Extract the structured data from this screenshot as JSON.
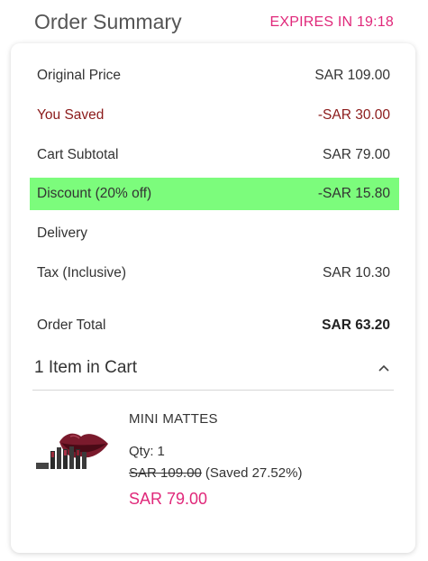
{
  "header": {
    "title": "Order Summary",
    "expires": "EXPIRES IN 19:18"
  },
  "summary": {
    "original_price": {
      "label": "Original Price",
      "value": "SAR 109.00"
    },
    "you_saved": {
      "label": "You Saved",
      "value": "-SAR 30.00"
    },
    "cart_subtotal": {
      "label": "Cart Subtotal",
      "value": "SAR 79.00"
    },
    "discount": {
      "label": "Discount (20% off)",
      "value": "-SAR 15.80"
    },
    "delivery": {
      "label": "Delivery",
      "value": ""
    },
    "tax": {
      "label": "Tax (Inclusive)",
      "value": "SAR 10.30"
    },
    "order_total": {
      "label": "Order Total",
      "value": "SAR 63.20"
    }
  },
  "cart": {
    "title": "1 Item in Cart",
    "toggle_icon": "chevron-up-icon",
    "items": [
      {
        "name": "MINI MATTES",
        "qty_label": "Qty:",
        "qty_value": "1",
        "original_price": "SAR 109.00",
        "saved_note": "(Saved 27.52%)",
        "price": "SAR 79.00",
        "image": "lipstick-product-image"
      }
    ]
  },
  "colors": {
    "accent": "#e0287a",
    "saved": "#8b1a1a",
    "discount_highlight": "#7cfc7c"
  }
}
